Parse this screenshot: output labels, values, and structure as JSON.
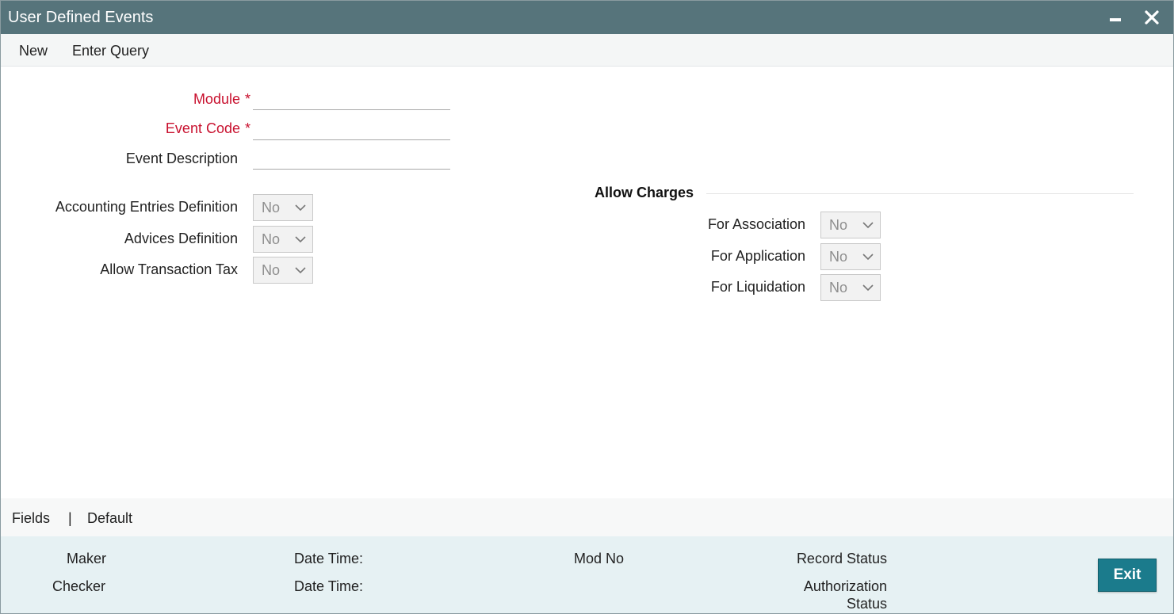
{
  "window": {
    "title": "User Defined Events"
  },
  "toolbar": {
    "new_label": "New",
    "enter_query_label": "Enter Query"
  },
  "form": {
    "module": {
      "label": "Module",
      "required_mark": "*",
      "value": ""
    },
    "event_code": {
      "label": "Event Code",
      "required_mark": "*",
      "value": ""
    },
    "event_description": {
      "label": "Event Description",
      "value": ""
    },
    "accounting_entries_definition": {
      "label": "Accounting Entries Definition",
      "value": "No"
    },
    "advices_definition": {
      "label": "Advices Definition",
      "value": "No"
    },
    "allow_transaction_tax": {
      "label": "Allow Transaction Tax",
      "value": "No"
    }
  },
  "allow_charges": {
    "title": "Allow Charges",
    "for_association": {
      "label": "For Association",
      "value": "No"
    },
    "for_application": {
      "label": "For Application",
      "value": "No"
    },
    "for_liquidation": {
      "label": "For Liquidation",
      "value": "No"
    }
  },
  "fields_bar": {
    "fields_label": "Fields",
    "separator": "|",
    "default_label": "Default"
  },
  "audit": {
    "maker_label": "Maker",
    "checker_label": "Checker",
    "date_time_label_1": "Date Time:",
    "date_time_label_2": "Date Time:",
    "mod_no_label": "Mod No",
    "record_status_label": "Record Status",
    "authorization_label": "Authorization",
    "status_label": "Status",
    "exit_label": "Exit"
  },
  "colors": {
    "titlebar": "#56747b",
    "required": "#c8102e",
    "audit_bg": "#e6f1f3",
    "exit_button": "#1b7b8c"
  },
  "icons": {
    "minimize": "minimize-icon",
    "close": "close-icon",
    "dropdown": "chevron-down-icon"
  }
}
